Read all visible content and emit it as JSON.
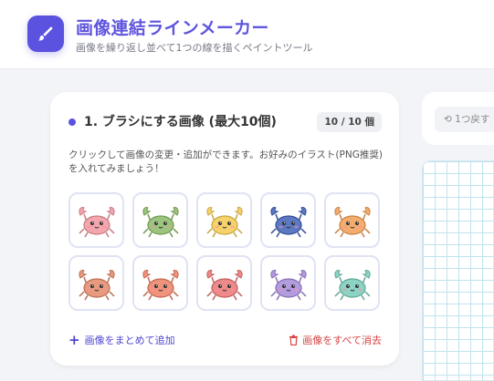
{
  "header": {
    "title": "画像連結ラインメーカー",
    "subtitle": "画像を繰り返し並べて1つの線を描くペイントツール",
    "logo_icon": "brush-icon",
    "accent_color": "#5b52e0"
  },
  "brush_panel": {
    "title": "1. ブラシにする画像 (最大10個)",
    "count": "10 / 10 個",
    "description": "クリックして画像の変更・追加ができます。お好みのイラスト(PNG推奨)を入れてみましょう！",
    "images": [
      {
        "name": "crab-pink",
        "color": "#f3a6ad"
      },
      {
        "name": "crab-green",
        "color": "#9cc47f"
      },
      {
        "name": "crab-yellow",
        "color": "#f5d26b"
      },
      {
        "name": "crab-blue",
        "color": "#5d79c4"
      },
      {
        "name": "crab-orange",
        "color": "#f4ad6e"
      },
      {
        "name": "crab-brown",
        "color": "#e79a7f"
      },
      {
        "name": "crab-coral",
        "color": "#f0937d"
      },
      {
        "name": "crab-red",
        "color": "#ee8a8a"
      },
      {
        "name": "crab-purple",
        "color": "#b39be0"
      },
      {
        "name": "crab-teal",
        "color": "#8dd3c4"
      }
    ],
    "add_label": "画像をまとめて追加",
    "clear_label": "画像をすべて消去"
  },
  "toolbar": {
    "undo_label": "1つ戻す"
  }
}
